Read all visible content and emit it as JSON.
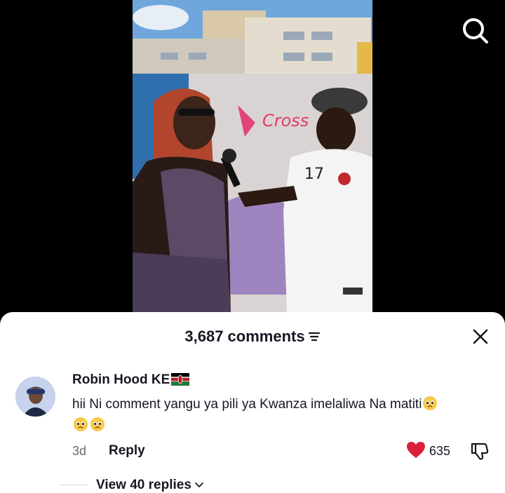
{
  "video": {
    "image_description": "Street interview video: woman with red braids and sunglasses in sequined outfit speaking into a microphone held by a man in a cap and white jersey, graffiti wall and buildings behind"
  },
  "icons": {
    "search": "search-icon",
    "filter": "filter-icon",
    "close": "close-icon",
    "like": "heart-icon",
    "dislike": "thumbs-down-icon",
    "chevron": "chevron-down-icon"
  },
  "comments_sheet": {
    "title": "3,687 comments",
    "comment": {
      "username": "Robin Hood KE",
      "text_line1": "hii Ni comment yangu ya pili ya Kwanza imelaliwa Na matiti",
      "time": "3d",
      "reply_label": "Reply",
      "like_count": "635",
      "view_replies": "View 40 replies"
    }
  },
  "colors": {
    "like_red": "#d8203a",
    "text": "#161823",
    "muted": "#6b6b73"
  }
}
